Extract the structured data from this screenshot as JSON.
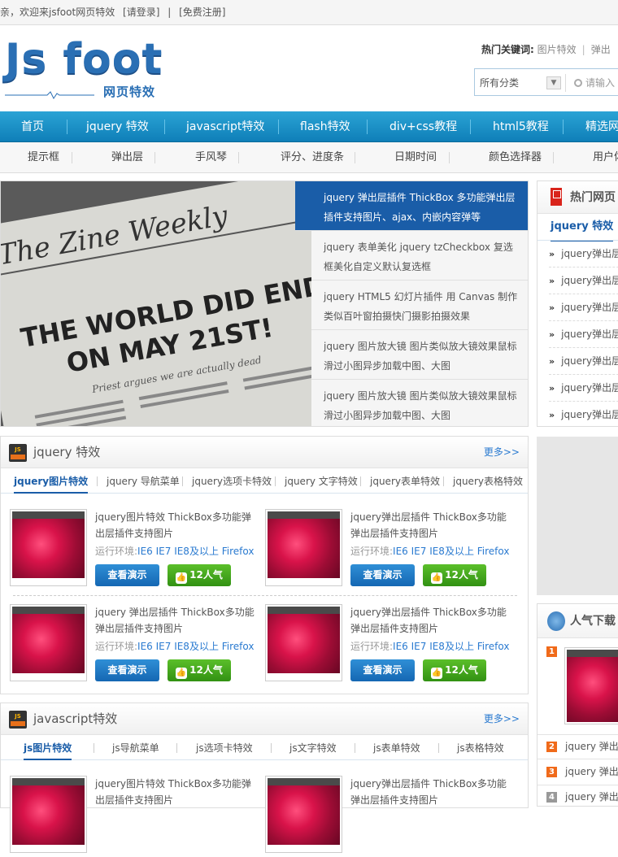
{
  "topbar": {
    "welcome": "亲，欢迎来jsfoot网页特效",
    "login": "[请登录]",
    "sep": "|",
    "register": "[免费注册]"
  },
  "logo": {
    "title": "Js foot",
    "subtitle": "网页特效",
    "brand_color": "#2a6fb4"
  },
  "hot_keywords": {
    "label": "热门关键词:",
    "items": [
      "图片特效",
      "弹出"
    ]
  },
  "search": {
    "category": "所有分类",
    "placeholder": "请输入"
  },
  "nav": {
    "items": [
      "首页",
      "jquery 特效",
      "javascript特效",
      "flash特效",
      "div+css教程",
      "html5教程",
      "精选网"
    ]
  },
  "subnav": {
    "items": [
      "提示框",
      "弹出层",
      "手风琴",
      "评分、进度条",
      "日期时间",
      "颜色选择器",
      "用户体"
    ]
  },
  "slider": {
    "items": [
      "jquery 弹出层插件 ThickBox 多功能弹出层插件支持图片、ajax、内嵌内容弹等",
      "jquery 表单美化 jquery tzCheckbox 复选框美化自定义默认复选框",
      "jquery HTML5 幻灯片插件 用 Canvas 制作类似百叶窗拍摄快门摄影拍摄效果",
      "jquery 图片放大镜 图片类似放大镜效果鼠标滑过小图异步加载中图、大图",
      "jquery 图片放大镜 图片类似放大镜效果鼠标滑过小图异步加载中图、大图"
    ],
    "photo_text": {
      "masthead": "The Zine Weekly",
      "headline_1": "THE WORLD DID END",
      "headline_2": "ON MAY 21ST!",
      "tagline": "Priest argues we are actually dead"
    }
  },
  "section1": {
    "icon": "JS",
    "title": "jquery 特效",
    "more": "更多>>",
    "tabs": [
      "jquery图片特效",
      "jquery 导航菜单",
      "jquery选项卡特效",
      "jquery 文字特效",
      "jquery表单特效",
      "jquery表格特效"
    ],
    "cards": [
      {
        "title": "jquery图片特效 ThickBox多功能弹出层插件支持图片",
        "env_label": "运行环境:",
        "env": "IE6 IE7 IE8及以上 Firefox",
        "demo": "查看演示",
        "pop": "12人气"
      },
      {
        "title": "jquery弹出层插件 ThickBox多功能弹出层插件支持图片",
        "env_label": "运行环境:",
        "env": "IE6 IE7 IE8及以上 Firefox",
        "demo": "查看演示",
        "pop": "12人气"
      },
      {
        "title": "jquery 弹出层插件 ThickBox多功能弹出层插件支持图片",
        "env_label": "运行环境:",
        "env": "IE6 IE7 IE8及以上 Firefox",
        "demo": "查看演示",
        "pop": "12人气"
      },
      {
        "title": "jquery弹出层插件 ThickBox多功能弹出层插件支持图片",
        "env_label": "运行环境:",
        "env": "IE6 IE7 IE8及以上 Firefox",
        "demo": "查看演示",
        "pop": "12人气"
      }
    ]
  },
  "section2": {
    "icon": "JS",
    "title": "javascript特效",
    "more": "更多>>",
    "tabs": [
      "js图片特效",
      "js导航菜单",
      "js选项卡特效",
      "js文字特效",
      "js表单特效",
      "js表格特效"
    ],
    "cards": [
      {
        "title": "jquery图片特效 ThickBox多功能弹出层插件支持图片"
      },
      {
        "title": "jquery弹出层插件 ThickBox多功能弹出层插件支持图片"
      }
    ]
  },
  "hot_side": {
    "title": "热门网页",
    "tab": "jquery 特效",
    "items": [
      "jquery弹出层",
      "jquery弹出层",
      "jquery弹出层",
      "jquery弹出层",
      "jquery弹出层",
      "jquery弹出层",
      "jquery弹出层"
    ]
  },
  "download_side": {
    "title": "人气下载",
    "ranks": [
      "1",
      "2",
      "3",
      "4"
    ],
    "items": [
      "jquery 弹出层",
      "jquery 弹出层",
      "jquery 弹出层"
    ],
    "rank_colors": [
      "#f06a1a",
      "#f06a1a",
      "#f06a1a",
      "#999999"
    ]
  }
}
